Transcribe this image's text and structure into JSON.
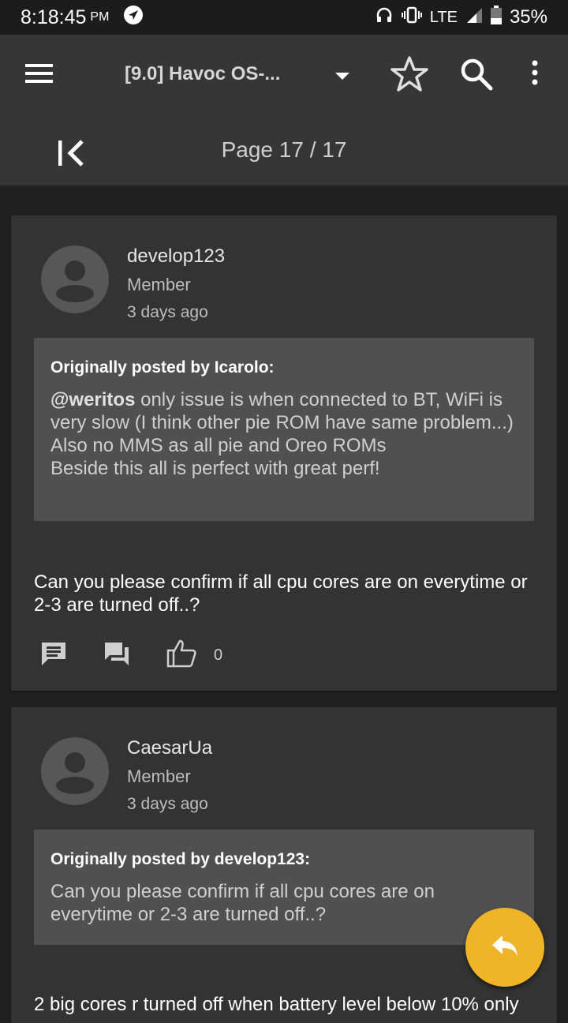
{
  "status_bar": {
    "time": "8:18:45",
    "ampm": "PM",
    "network": "LTE",
    "battery": "35%"
  },
  "app_bar": {
    "title": "[9.0] Havoc OS-..."
  },
  "pagination": {
    "label": "Page 17 / 17"
  },
  "posts": [
    {
      "author": "develop123",
      "role": "Member",
      "time": "3 days ago",
      "quote_header": "Originally posted by Icarolo:",
      "quote_mention": "@weritos",
      "quote_text": " only issue is when connected to BT, WiFi is very slow (I think other pie ROM have same problem...)",
      "quote_line2": "Also no MMS as all pie and Oreo ROMs",
      "quote_line3": "Beside this all is perfect with great perf!",
      "body": "Can you please confirm if all cpu cores are on everytime or 2-3 are turned off..?",
      "likes": "0"
    },
    {
      "author": "CaesarUa",
      "role": "Member",
      "time": "3 days ago",
      "quote_header": "Originally posted by develop123:",
      "quote_text": "Can you please confirm if all cpu cores are on everytime or 2-3 are turned off..?",
      "body": "2 big cores r turned off when battery level below 10% only"
    }
  ],
  "colors": {
    "accent": "#f0b429",
    "card": "#333333",
    "quote": "#505050"
  }
}
